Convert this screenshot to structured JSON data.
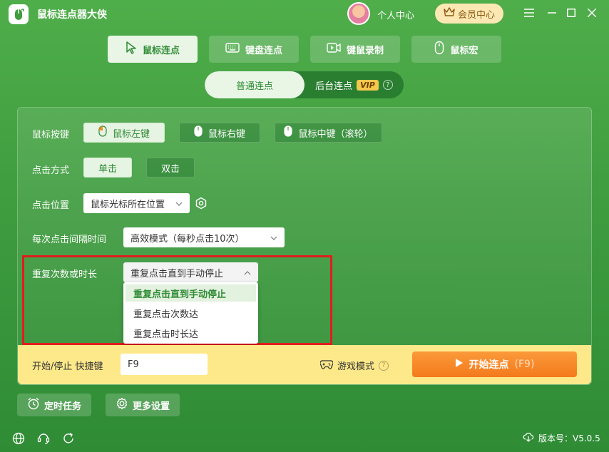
{
  "app": {
    "title": "鼠标连点器大侠"
  },
  "header": {
    "personal_center": "个人中心",
    "member_center": "会员中心"
  },
  "mode_tabs": [
    {
      "label": "鼠标连点",
      "icon": "cursor-arrow-icon",
      "active": true
    },
    {
      "label": "键盘连点",
      "icon": "keyboard-icon",
      "active": false
    },
    {
      "label": "键鼠录制",
      "icon": "video-record-icon",
      "active": false
    },
    {
      "label": "鼠标宏",
      "icon": "mouse-icon",
      "active": false
    }
  ],
  "sub_toggle": {
    "normal": "普通连点",
    "background": "后台连点",
    "vip": "VIP",
    "help": "?"
  },
  "settings": {
    "mouse_button": {
      "label": "鼠标按键",
      "options": [
        "鼠标左键",
        "鼠标右键",
        "鼠标中键（滚轮）"
      ],
      "selected": "鼠标左键"
    },
    "click_mode": {
      "label": "点击方式",
      "options": [
        "单击",
        "双击"
      ],
      "selected": "单击"
    },
    "click_position": {
      "label": "点击位置",
      "value": "鼠标光标所在位置"
    },
    "interval": {
      "label": "每次点击间隔时间",
      "value": "高效模式（每秒点击10次）"
    },
    "repeat": {
      "label": "重复次数或时长",
      "value": "重复点击直到手动停止",
      "options": [
        "重复点击直到手动停止",
        "重复点击次数达",
        "重复点击时长达"
      ],
      "highlighted": "重复点击直到手动停止"
    }
  },
  "hotkey": {
    "label": "开始/停止 快捷键",
    "value": "F9"
  },
  "game_mode": {
    "label": "游戏模式",
    "help": "?"
  },
  "start_button": {
    "label": "开始连点",
    "key": "(F9)"
  },
  "bottom": {
    "timer_task": "定时任务",
    "more_settings": "更多设置"
  },
  "footer": {
    "version_label": "版本号：V5.0.5"
  },
  "colors": {
    "brand_green": "#3f9c3f",
    "accent_orange": "#f37a1c",
    "highlight_red": "#e21c1c",
    "yellow_bar": "#fde98a"
  }
}
